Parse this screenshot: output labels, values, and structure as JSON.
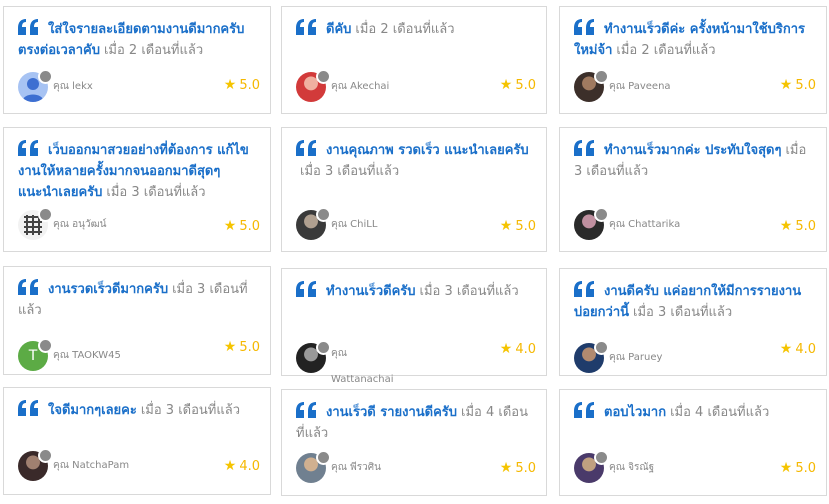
{
  "reviews": [
    {
      "text": "ใส่ใจรายละเอียดตามงานดีมากครับ ตรงต่อเวลาคับ",
      "time": "เมื่อ 2 เดือนที่แล้ว",
      "author_prefix": "คุณ",
      "author": "lekx",
      "rating": "5.0",
      "avatar": "default-avatar"
    },
    {
      "text": "ดีคับ",
      "time": "เมื่อ 2 เดือนที่แล้ว",
      "author_prefix": "คุณ",
      "author": "Akechai",
      "rating": "5.0",
      "avatar": "photo-avatar"
    },
    {
      "text": "ทำงานเร็วดีค่ะ ครั้งหน้ามาใช้บริการใหม่จ้า",
      "time": "เมื่อ 2 เดือนที่แล้ว",
      "author_prefix": "คุณ",
      "author": "Paveena",
      "rating": "5.0",
      "avatar": "photo-avatar"
    },
    {
      "text": "เว็บออกมาสวยอย่างที่ต้องการ แก้ไขงานให้หลายครั้งมากจนออกมาดีสุดๆ แนะนำเลยครับ",
      "time": "เมื่อ 3 เดือนที่แล้ว",
      "author_prefix": "คุณ",
      "author": "อนุวัฒน์",
      "rating": "5.0",
      "avatar": "pattern-avatar"
    },
    {
      "text": "งานคุณภาพ รวดเร็ว แนะนำเลยครับ",
      "time": "เมื่อ 3 เดือนที่แล้ว",
      "author_prefix": "คุณ",
      "author": "ChiLL",
      "rating": "5.0",
      "avatar": "photo-avatar"
    },
    {
      "text": "ทำงานเร็วมากค่ะ ประทับใจสุดๆ",
      "time": "เมื่อ 3 เดือนที่แล้ว",
      "author_prefix": "คุณ",
      "author": "Chattarika",
      "rating": "5.0",
      "avatar": "photo-avatar"
    },
    {
      "text": "งานรวดเร็วดีมากครับ",
      "time": "เมื่อ 3 เดือนที่แล้ว",
      "author_prefix": "คุณ",
      "author": "TAOKW45",
      "rating": "5.0",
      "avatar": "letter-avatar",
      "avatar_letter": "T"
    },
    {
      "text": "ทำงานเร็วดีครับ",
      "time": "เมื่อ 3 เดือนที่แล้ว",
      "author_prefix": "คุณ",
      "author": "Wattanachai",
      "rating": "4.0",
      "avatar": "photo-avatar"
    },
    {
      "text": "งานดีครับ แค่อยากให้มีการรายงานบ่อยกว่านี้",
      "time": "เมื่อ 3 เดือนที่แล้ว",
      "author_prefix": "คุณ",
      "author": "Paruey",
      "rating": "4.0",
      "avatar": "photo-avatar"
    },
    {
      "text": "ใจดีมากๆเลยคะ",
      "time": "เมื่อ 3 เดือนที่แล้ว",
      "author_prefix": "คุณ",
      "author": "NatchaPam",
      "rating": "4.0",
      "avatar": "photo-avatar"
    },
    {
      "text": "งานเร็วดี รายงานดีครับ",
      "time": "เมื่อ 4 เดือนที่แล้ว",
      "author_prefix": "คุณ",
      "author": "พีรวศิน",
      "rating": "5.0",
      "avatar": "photo-avatar"
    },
    {
      "text": "ตอบไวมาก",
      "time": "เมื่อ 4 เดือนที่แล้ว",
      "author_prefix": "คุณ",
      "author": "จิรณัฐ",
      "rating": "5.0",
      "avatar": "photo-avatar"
    }
  ],
  "colors": {
    "accent": "#1a6fc9",
    "star": "#f5c400",
    "rating_text": "#f5b800",
    "muted_text": "#888888",
    "card_border": "#d9d9d9",
    "status_dot": "#8a8a8a",
    "letter_avatar_bg": "#5cab45"
  }
}
